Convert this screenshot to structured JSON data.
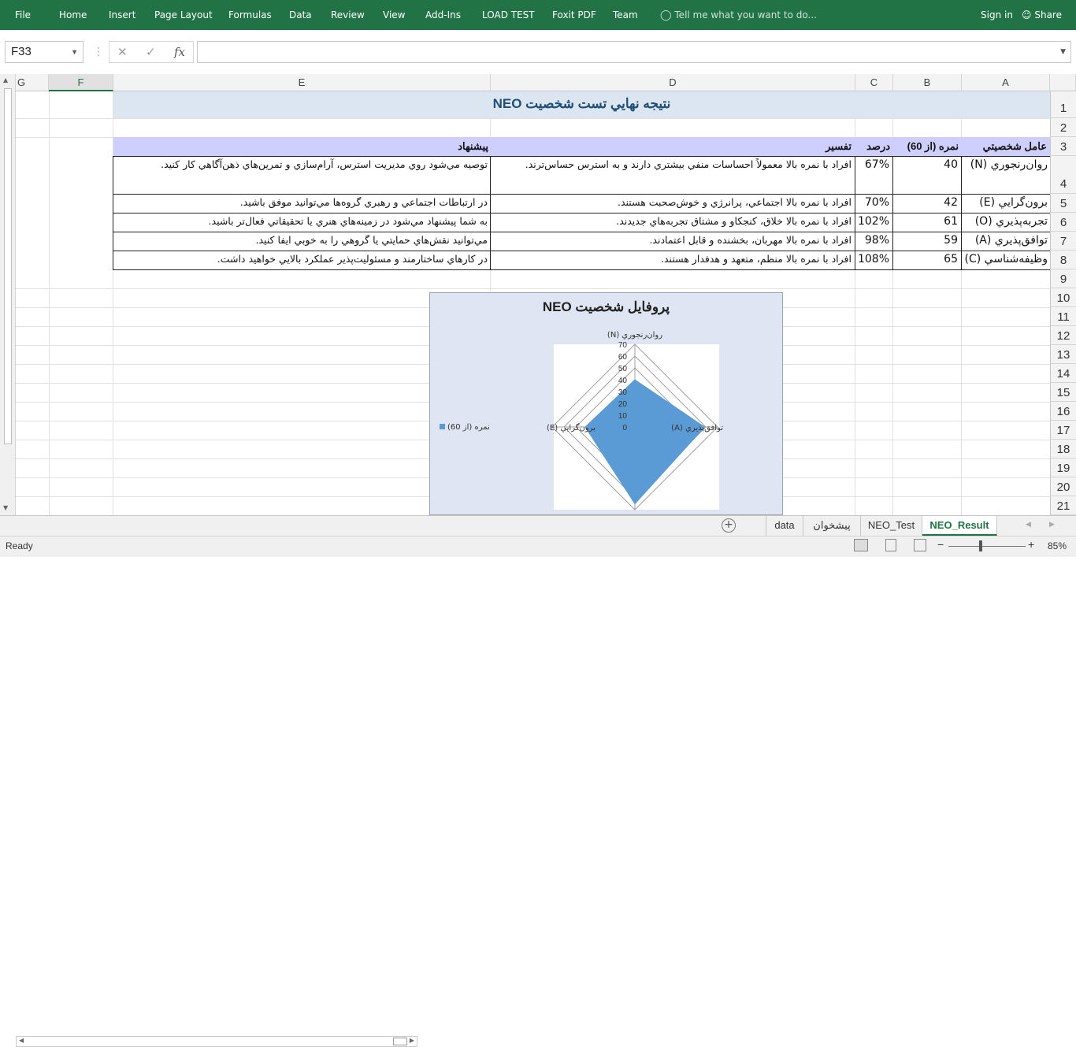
{
  "ribbon": {
    "file": "File",
    "tabs": [
      "Home",
      "Insert",
      "Page Layout",
      "Formulas",
      "Data",
      "Review",
      "View",
      "Add-Ins",
      "LOAD TEST",
      "Foxit PDF",
      "Team"
    ],
    "tell_me": "Tell me what you want to do...",
    "sign_in": "Sign in",
    "share": "Share",
    "colors": {
      "ribbon": "#217346"
    }
  },
  "formula_bar": {
    "name_box": "F33",
    "cancel": "✕",
    "enter": "✓",
    "fx": "fx",
    "formula": ""
  },
  "columns": [
    "G",
    "F",
    "E",
    "D",
    "C",
    "B",
    "A"
  ],
  "rows": [
    "1",
    "2",
    "3",
    "4",
    "5",
    "6",
    "7",
    "8",
    "9",
    "10",
    "11",
    "12",
    "13",
    "14",
    "15",
    "16",
    "17",
    "18",
    "19",
    "20",
    "21"
  ],
  "sheet": {
    "title": "نتيجه نهايي تست شخصيت NEO",
    "headers": {
      "factor": "عامل شخصيتي",
      "score": "نمره (از 60)",
      "percent": "درصد",
      "interpretation": "تفسير",
      "suggestion": "پيشنهاد"
    },
    "table": [
      {
        "factor": "روان‌رنجوري (N)",
        "score": "40",
        "percent": "67%",
        "interpretation": "افراد با نمره بالا معمولاً احساسات منفي بيشتري دارند و به استرس حساس‌ترند.",
        "suggestion": "توصيه مي‌شود روي مديريت استرس، آرام‌سازي و تمرين‌هاي ذهن‌آگاهي كار كنيد."
      },
      {
        "factor": "برون‌گرايي (E)",
        "score": "42",
        "percent": "70%",
        "interpretation": "افراد با نمره بالا اجتماعي، پرانرژي و خوش‌صحبت هستند.",
        "suggestion": "در ارتباطات اجتماعي و رهبري گروه‌ها مي‌توانيد موفق باشيد."
      },
      {
        "factor": "تجربه‌پذيري (O)",
        "score": "61",
        "percent": "102%",
        "interpretation": "افراد با نمره بالا خلاق، كنجكاو و مشتاق تجربه‌هاي جديدند.",
        "suggestion": "به شما پيشنهاد مي‌شود در زمينه‌هاي هنري يا تحقيقاتي فعال‌تر باشيد."
      },
      {
        "factor": "توافق‌پذيري (A)",
        "score": "59",
        "percent": "98%",
        "interpretation": "افراد با نمره بالا مهربان، بخشنده و قابل اعتمادند.",
        "suggestion": "مي‌توانيد نقش‌هاي حمايتي يا گروهي را به خوبي ايفا كنيد."
      },
      {
        "factor": "وظيفه‌شناسي (C)",
        "score": "65",
        "percent": "108%",
        "interpretation": "افراد با نمره بالا منظم، متعهد و هدفدار هستند.",
        "suggestion": "در كارهاي ساختارمند و مسئوليت‌پذير عملكرد بالايي خواهيد داشت."
      }
    ]
  },
  "chart_data": {
    "type": "radar",
    "title": "پروفايل شخصيت NEO",
    "categories": [
      "روان‌رنجوري (N)",
      "توافق‌پذيري (A)",
      "",
      "برون‌گرايي (E)"
    ],
    "series": [
      {
        "name": "نمره (از 60)",
        "values": [
          40,
          59,
          65,
          42
        ],
        "color": "#5b9bd5"
      }
    ],
    "ticks": [
      "0",
      "10",
      "20",
      "30",
      "40",
      "50",
      "60",
      "70"
    ],
    "ylim": [
      0,
      70
    ],
    "legend": "left"
  },
  "sheet_tabs": [
    "data",
    "پيشخوان",
    "NEO_Test",
    "NEO_Result"
  ],
  "active_tab": "NEO_Result",
  "status": {
    "ready": "Ready",
    "zoom": "85%"
  }
}
